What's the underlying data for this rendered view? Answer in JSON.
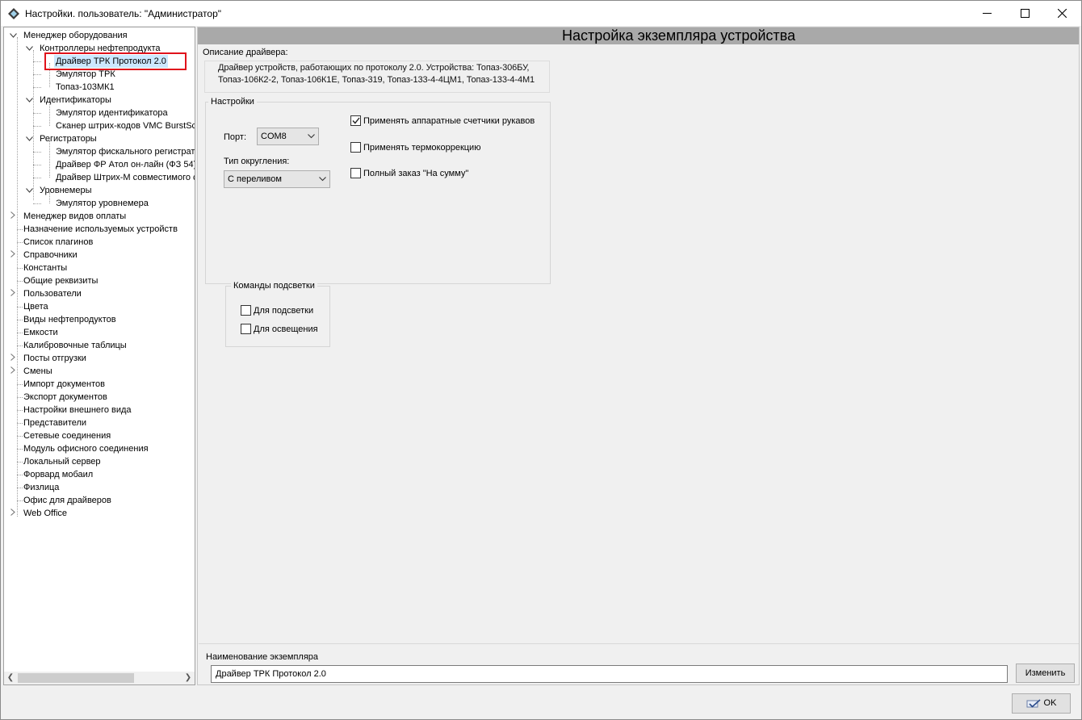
{
  "window": {
    "title": "Настройки. пользователь: \"Администратор\""
  },
  "tree": {
    "items": [
      {
        "label": "Менеджер оборудования",
        "state": "expanded"
      },
      {
        "label": "Контроллеры нефтепродукта",
        "state": "expanded"
      },
      {
        "label": "Драйвер ТРК Протокол 2.0",
        "selected": true
      },
      {
        "label": "Эмулятор ТРК"
      },
      {
        "label": "Топаз-103МК1"
      },
      {
        "label": "Идентификаторы",
        "state": "expanded"
      },
      {
        "label": "Эмулятор идентификатора"
      },
      {
        "label": "Сканер штрих-кодов VMC BurstSc"
      },
      {
        "label": "Регистраторы",
        "state": "expanded"
      },
      {
        "label": "Эмулятор фискального регистрат"
      },
      {
        "label": "Драйвер ФР Атол он-лайн (ФЗ 54)"
      },
      {
        "label": "Драйвер Штрих-М совместимого с"
      },
      {
        "label": "Уровнемеры",
        "state": "expanded"
      },
      {
        "label": "Эмулятор уровнемера"
      },
      {
        "label": "Менеджер видов оплаты",
        "state": "collapsed"
      },
      {
        "label": "Назначение используемых устройств"
      },
      {
        "label": "Список плагинов"
      },
      {
        "label": "Справочники",
        "state": "collapsed"
      },
      {
        "label": "Константы"
      },
      {
        "label": "Общие реквизиты"
      },
      {
        "label": "Пользователи",
        "state": "collapsed"
      },
      {
        "label": "Цвета"
      },
      {
        "label": "Виды нефтепродуктов"
      },
      {
        "label": "Емкости"
      },
      {
        "label": "Калибровочные таблицы"
      },
      {
        "label": "Посты отгрузки",
        "state": "collapsed"
      },
      {
        "label": "Смены",
        "state": "collapsed"
      },
      {
        "label": "Импорт документов"
      },
      {
        "label": "Экспорт документов"
      },
      {
        "label": "Настройки внешнего вида"
      },
      {
        "label": "Представители"
      },
      {
        "label": "Сетевые соединения"
      },
      {
        "label": "Модуль офисного соединения"
      },
      {
        "label": "Локальный сервер"
      },
      {
        "label": "Форвард мобаил"
      },
      {
        "label": "Физлица"
      },
      {
        "label": "Офис для драйверов"
      },
      {
        "label": "Web Office",
        "state": "collapsed"
      }
    ]
  },
  "panel": {
    "header": "Настройка экземпляра устройства",
    "description_label": "Описание драйвера:",
    "description_text": "Драйвер устройств, работающих по протоколу 2.0. Устройства: Топаз-306БУ, Топаз-106К2-2, Топаз-106К1Е, Топаз-319, Топаз-133-4-4ЦМ1, Топаз-133-4-4М1",
    "settings": {
      "title": "Настройки",
      "port_label": "Порт:",
      "port_value": "COM8",
      "rounding_label": "Тип округления:",
      "rounding_value": "С переливом",
      "hw_counters_label": "Применять аппаратные счетчики рукавов",
      "hw_counters_checked": true,
      "thermo_label": "Применять термокоррекцию",
      "thermo_checked": false,
      "full_order_label": "Полный заказ \"На сумму\"",
      "full_order_checked": false,
      "light_commands": {
        "title": "Команды подсветки",
        "backlight_label": "Для подсветки",
        "backlight_checked": false,
        "lighting_label": "Для освещения",
        "lighting_checked": false
      }
    },
    "instance": {
      "label": "Наименование экземпляра",
      "value": "Драйвер ТРК Протокол 2.0",
      "change_button": "Изменить"
    }
  },
  "footer": {
    "ok_button": "OK"
  },
  "colors": {
    "header_bg": "#a9a9a9",
    "selection_bg": "#cce8ff",
    "highlight_border": "#e0121b"
  }
}
